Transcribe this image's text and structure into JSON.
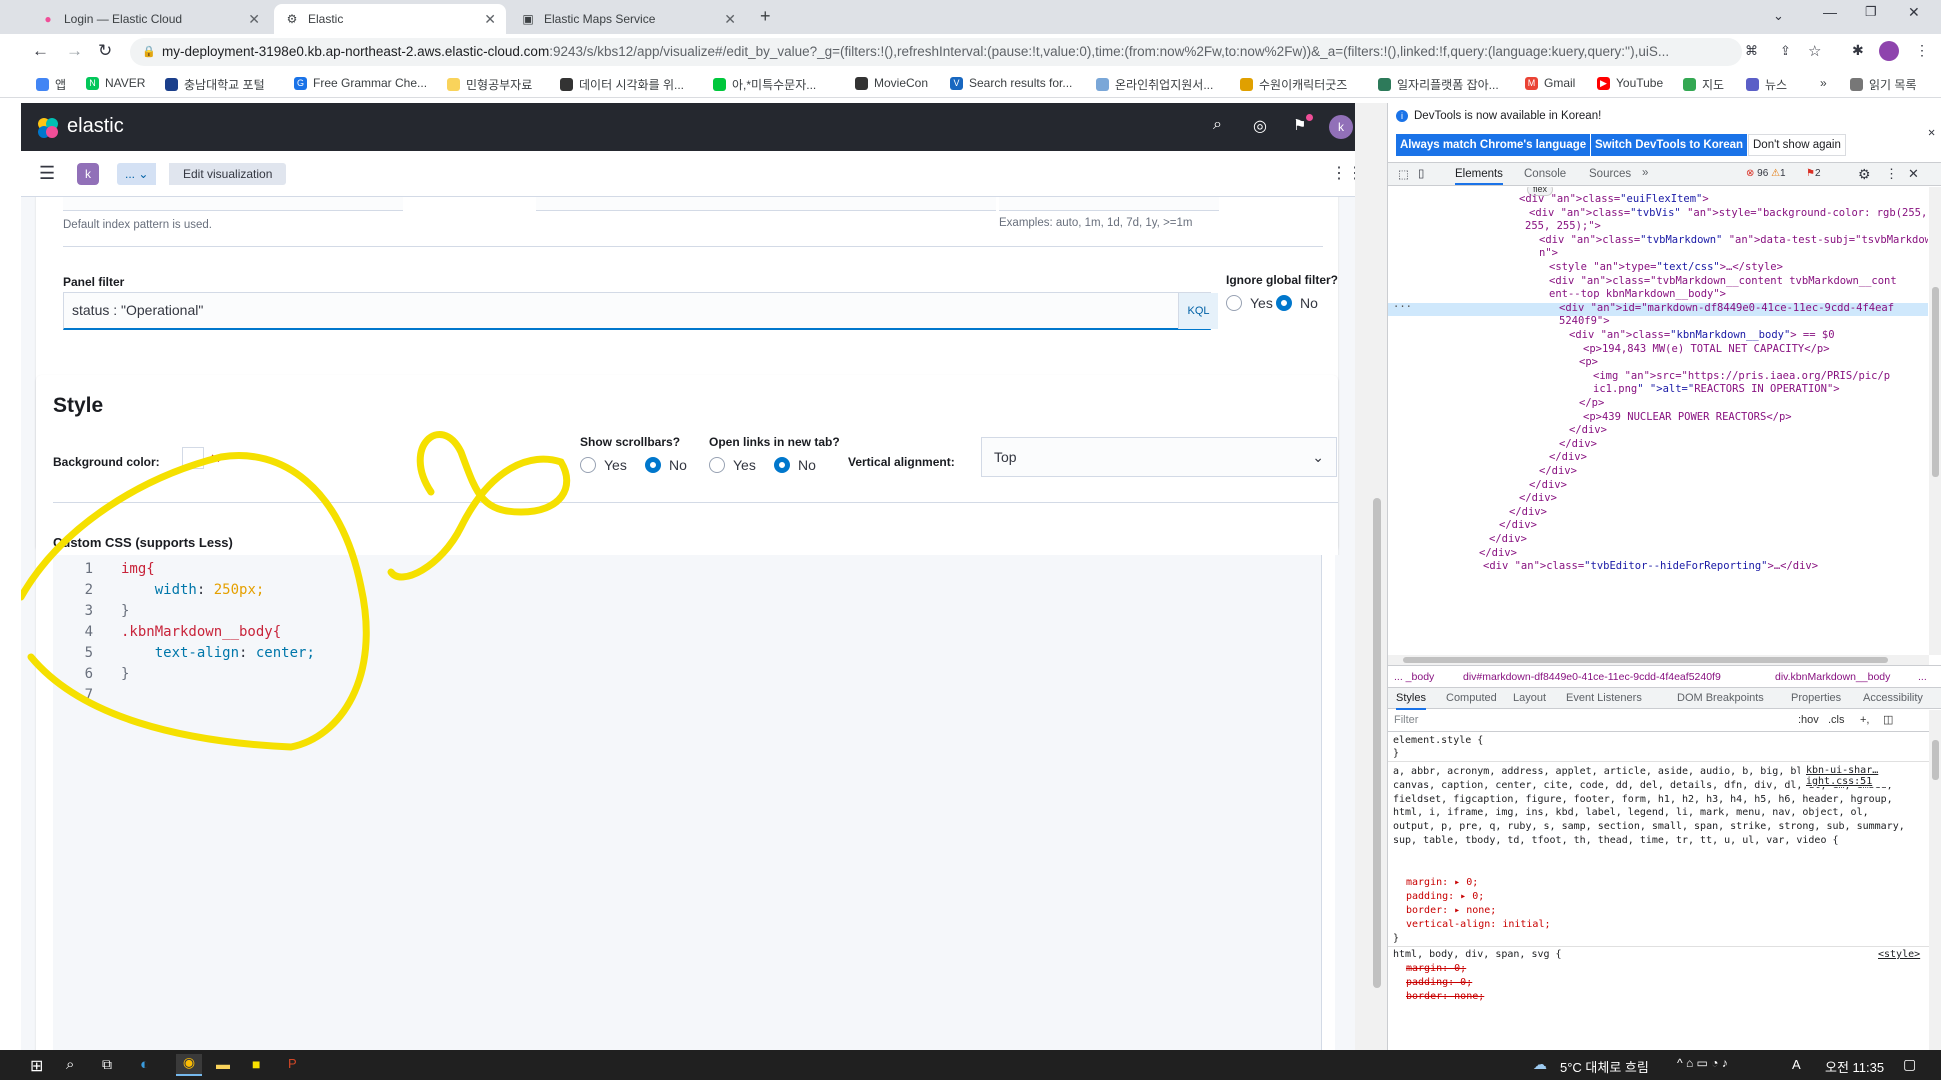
{
  "browser": {
    "tabs": [
      {
        "title": "Login — Elastic Cloud"
      },
      {
        "title": "Elastic"
      },
      {
        "title": "Elastic Maps Service"
      }
    ],
    "url_host": "my-deployment-3198e0.kb.ap-northeast-2.aws.elastic-cloud.com",
    "url_rest": ":9243/s/kbs12/app/visualize#/edit_by_value?_g=(filters:!(),refreshInterval:(pause:!t,value:0),time:(from:now%2Fw,to:now%2Fw))&_a=(filters:!(),linked:!f,query:(language:kuery,query:''),uiS...",
    "bookmarks": [
      "앱",
      "NAVER",
      "충남대학교 포털",
      "Free Grammar Che...",
      "민형공부자료",
      "데이터 시각화를 위...",
      "아,*미특수문자...",
      "MovieCon",
      "Search results for...",
      "온라인취업지원서...",
      "수원이캐릭터굿즈",
      "일자리플랫폼 잡아...",
      "Gmail",
      "YouTube",
      "지도",
      "뉴스"
    ],
    "reading_list": "읽기 목록",
    "more": "»"
  },
  "kibana": {
    "brand": "elastic",
    "avatar": "k",
    "space": "k",
    "breadcrumb_more": "... ⌄",
    "breadcrumb_current": "Edit visualization",
    "index_hint": "Default index pattern is used.",
    "interval_hint": "Examples: auto, 1m, 1d, 7d, 1y, >=1m",
    "panel_filter_label": "Panel filter",
    "panel_filter_value": "status : \"Operational\"",
    "kql": "KQL",
    "ignore_global_label": "Ignore global filter?",
    "yes": "Yes",
    "no": "No",
    "style_title": "Style",
    "bg_color_label": "Background color:",
    "show_scrollbars_label": "Show scrollbars?",
    "open_links_label": "Open links in new tab?",
    "vertical_alignment_label": "Vertical alignment:",
    "vertical_alignment_value": "Top",
    "custom_css_label": "Custom CSS (supports Less)",
    "code_lines": [
      {
        "n": "1",
        "text": "img{"
      },
      {
        "n": "2",
        "text": "    width: 250px;"
      },
      {
        "n": "3",
        "text": "}"
      },
      {
        "n": "4",
        "text": ".kbnMarkdown__body{"
      },
      {
        "n": "5",
        "text": "    text-align: center;"
      },
      {
        "n": "6",
        "text": "}"
      },
      {
        "n": "7",
        "text": ""
      }
    ]
  },
  "devtools": {
    "notice": "DevTools is now available in Korean!",
    "btn_match": "Always match Chrome's language",
    "btn_switch": "Switch DevTools to Korean",
    "btn_dont": "Don't show again",
    "tabs": [
      "Elements",
      "Console",
      "Sources",
      "»"
    ],
    "errors": "96",
    "warnings": "1",
    "issues": "2",
    "dom_lines": [
      "<div class=\"euiFlexItem\">",
      "<div class=\"tvbVis\" style=\"background-color: rgb(255,",
      "255, 255);\">",
      "<div class=\"tvbMarkdown\" data-test-subj=\"tsvbMarkdow",
      "n\">",
      "<style type=\"text/css\">…</style>",
      "<div class=\"tvbMarkdown__content tvbMarkdown__cont",
      "ent--top kbnMarkdown__body\">",
      "<div id=\"markdown-df8449e0-41ce-11ec-9cdd-4f4eaf",
      "5240f9\">",
      "<div class=\"kbnMarkdown__body\"> == $0",
      "<p>194,843 MW(e) TOTAL NET CAPACITY</p>",
      "<p>",
      "<img src=\"https://pris.iaea.org/PRIS/pic/p",
      "ic1.png\" alt=\"REACTORS IN OPERATION\">",
      "</p>",
      "<p>439 NUCLEAR POWER REACTORS</p>",
      "</div>",
      "</div>",
      "</div>",
      "</div>",
      "</div>",
      "</div>",
      "</div>",
      "</div>",
      "</div>",
      "</div>",
      "<div class=\"tvbEditor--hideForReporting\">…</div>"
    ],
    "crumbs": [
      "... _body",
      "div#markdown-df8449e0-41ce-11ec-9cdd-4f4eaf5240f9",
      "div.kbnMarkdown__body",
      "..."
    ],
    "sub_tabs": [
      "Styles",
      "Computed",
      "Layout",
      "Event Listeners",
      "DOM Breakpoints",
      "Properties",
      "Accessibility"
    ],
    "filter_placeholder": "Filter",
    "hov": ":hov",
    "cls": ".cls",
    "rule1": "element.style {",
    "rule_close": "}",
    "rule2_src": "kbn-ui-shar…ight.css:51",
    "rule2_selectors": "a, abbr, acronym, address, applet, article, aside, audio, b, big, blockquote, body, canvas, caption, center, cite, code, dd, del, details, dfn, div, dl, dt, em, embed, fieldset, figcaption, figure, footer, form, h1, h2, h3, h4, h5, h6, header, hgroup, html, i, iframe, img, ins, kbd, label, legend, li, mark, menu, nav, object, ol, output, p, pre, q, ruby, s, samp, section, small, span, strike, strong, sub, summary, sup, table, tbody, td, tfoot, th, thead, time, tr, tt, u, ul, var, video {",
    "props": [
      "margin: ▸ 0;",
      "padding: ▸ 0;",
      "border: ▸ none;",
      "vertical-align: initial;"
    ],
    "rule3": "html, body, div, span, svg {",
    "rule3_src": "<style>",
    "rule3_props": [
      "margin: 0;",
      "padding: 0;",
      "border: none;"
    ]
  },
  "taskbar": {
    "weather": "5°C 대체로 흐림",
    "ime": "A",
    "time": "오전 11:35"
  },
  "colors": {
    "annotation": "#f5e000",
    "kibana_header": "#25282f",
    "accent": "#0077cc"
  }
}
